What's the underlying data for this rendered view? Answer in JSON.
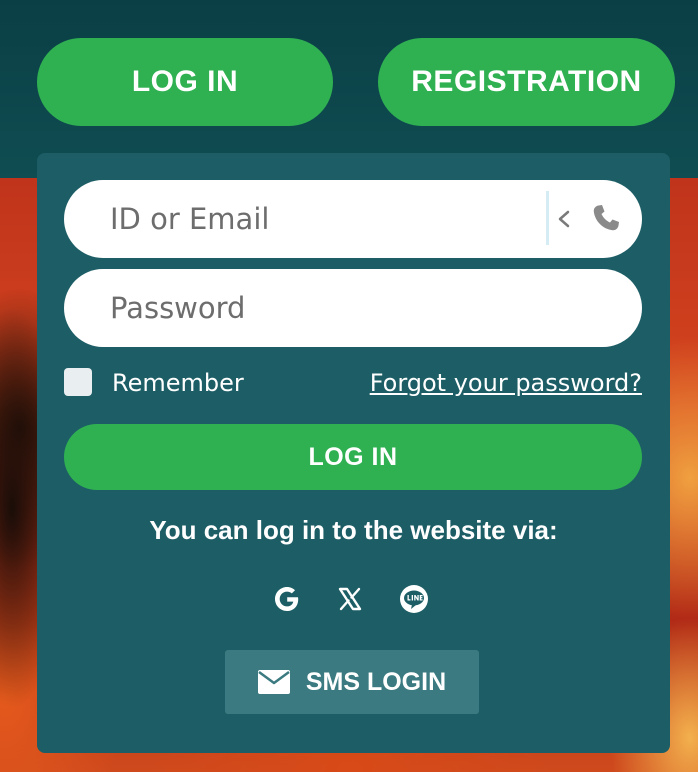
{
  "header": {
    "login_label": "LOG IN",
    "registration_label": "REGISTRATION"
  },
  "form": {
    "id_placeholder": "ID or Email",
    "password_placeholder": "Password",
    "remember_label": "Remember",
    "forgot_label": "Forgot your password?",
    "login_button_label": "LOG IN",
    "via_text": "You can log in to the website via:",
    "social_icons": [
      "google-icon",
      "x-icon",
      "line-icon"
    ],
    "sms_label": "SMS LOGIN"
  },
  "colors": {
    "accent_green": "#2fb152",
    "panel": "#1d5e66",
    "header": "#0d4a4f",
    "sms_button": "#3a7a80"
  }
}
